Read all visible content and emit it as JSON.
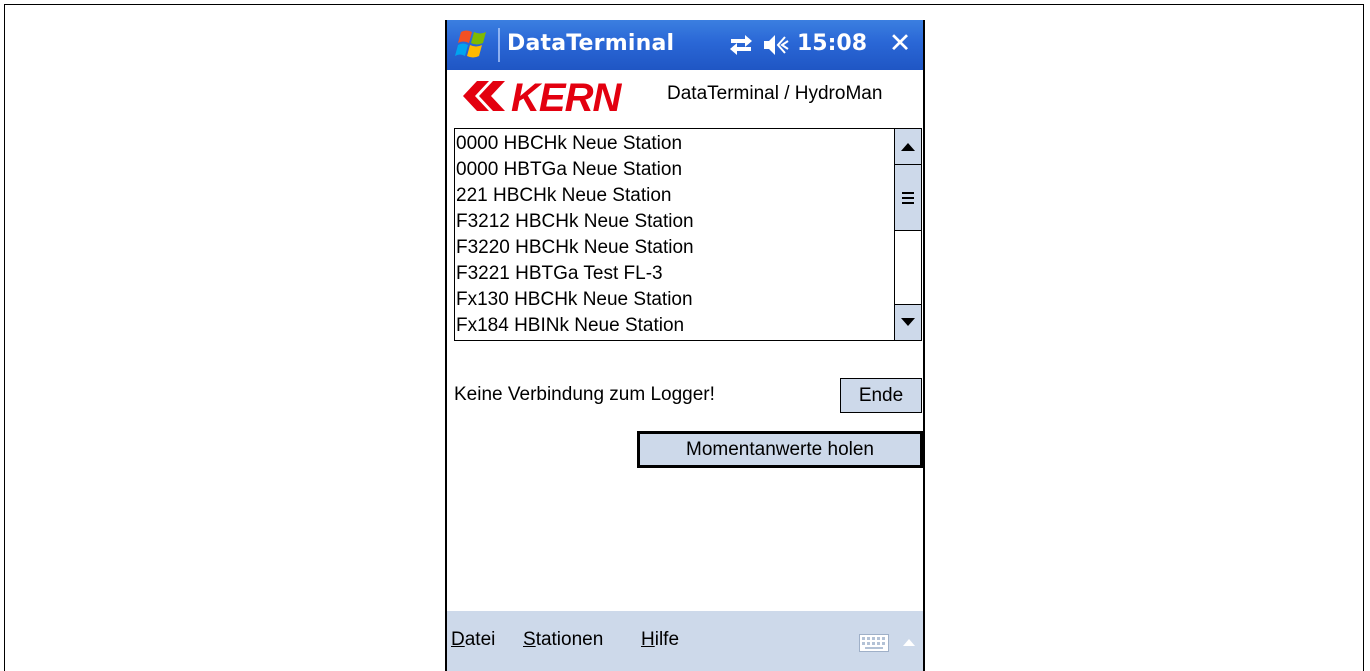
{
  "titlebar": {
    "title": "DataTerminal",
    "clock": "15:08",
    "close_symbol": "✕",
    "start_icon": "windows-flag-icon",
    "connectivity_icon": "connectivity-icon",
    "volume_icon": "speaker-off-icon"
  },
  "header": {
    "logo_text": "KERN",
    "subtitle": "DataTerminal / HydroMan"
  },
  "stations": {
    "items": [
      "0000 HBCHk Neue Station",
      "0000 HBTGa Neue Station",
      "221 HBCHk Neue Station",
      "F3212 HBCHk Neue Station",
      "F3220 HBCHk Neue Station",
      "F3221 HBTGa Test FL-3",
      "Fx130 HBCHk Neue Station",
      "Fx184 HBINk Neue Station"
    ]
  },
  "status": {
    "message": "Keine Verbindung zum Logger!"
  },
  "buttons": {
    "ende": "Ende",
    "momentanwerte": "Momentanwerte holen"
  },
  "menu": {
    "datei": {
      "accel": "D",
      "rest": "atei"
    },
    "stationen": {
      "accel": "S",
      "rest": "tationen"
    },
    "hilfe": {
      "accel": "H",
      "rest": "ilfe"
    },
    "keyboard_icon": "keyboard-icon"
  },
  "colors": {
    "titlebar": "#2a67d6",
    "button_face": "#cdd9ea",
    "logo_red": "#e3000f"
  }
}
